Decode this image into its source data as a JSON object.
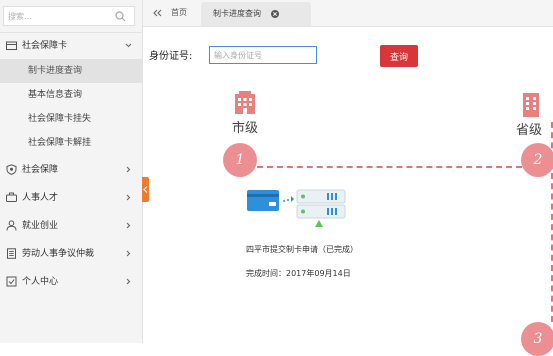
{
  "sidebar": {
    "search_placeholder": "搜索...",
    "menus": [
      {
        "label": "社会保障卡",
        "icon": "card-icon",
        "expanded": true
      },
      {
        "label": "社会保障",
        "icon": "shield-icon"
      },
      {
        "label": "人事人才",
        "icon": "people-icon"
      },
      {
        "label": "就业创业",
        "icon": "user-icon"
      },
      {
        "label": "劳动人事争议仲裁",
        "icon": "document-icon"
      },
      {
        "label": "个人中心",
        "icon": "checkbox-icon"
      }
    ],
    "sub_items": [
      "制卡进度查询",
      "基本信息查询",
      "社会保障卡挂失",
      "社会保障卡解挂"
    ],
    "active_sub_item": "制卡进度查询"
  },
  "tabbar": {
    "home_label": "首页",
    "active_tab_label": "制卡进度查询"
  },
  "form": {
    "id_label": "身份证号:",
    "id_placeholder": "输入身份证号",
    "id_value": "",
    "query_label": "查询"
  },
  "process": {
    "levels": {
      "city": "市级",
      "province": "省级"
    },
    "steps": [
      "1",
      "2",
      "3"
    ],
    "step1_description": "四平市提交制卡申请（已完成）",
    "step1_time": "完成时间：2017年09月14日"
  },
  "colors": {
    "accent_red": "#d9363b",
    "step_circle": "#ec8f93",
    "dash_line": "#e2737a",
    "collapse_tab": "#f07a2e",
    "input_border": "#4a90d9"
  }
}
